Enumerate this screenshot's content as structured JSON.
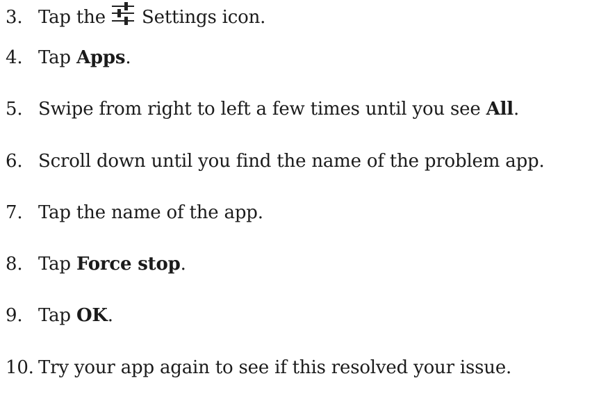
{
  "steps": [
    {
      "num": "3.",
      "pre": "Tap the ",
      "icon": "settings-sliders-icon",
      "post": " Settings icon."
    },
    {
      "num": "4.",
      "pre": "Tap ",
      "bold": "Apps",
      "post": "."
    },
    {
      "num": "5.",
      "pre": "Swipe from right to left a few times until you see ",
      "bold": "All",
      "post": "."
    },
    {
      "num": "6.",
      "pre": "Scroll down until you find the name of the problem app.",
      "bold": "",
      "post": ""
    },
    {
      "num": "7.",
      "pre": "Tap the name of the app.",
      "bold": "",
      "post": ""
    },
    {
      "num": "8.",
      "pre": "Tap ",
      "bold": "Force stop",
      "post": "."
    },
    {
      "num": "9.",
      "pre": "Tap ",
      "bold": "OK",
      "post": "."
    },
    {
      "num": "10.",
      "pre": "Try your app again to see if this resolved your issue.",
      "bold": "",
      "post": ""
    }
  ]
}
